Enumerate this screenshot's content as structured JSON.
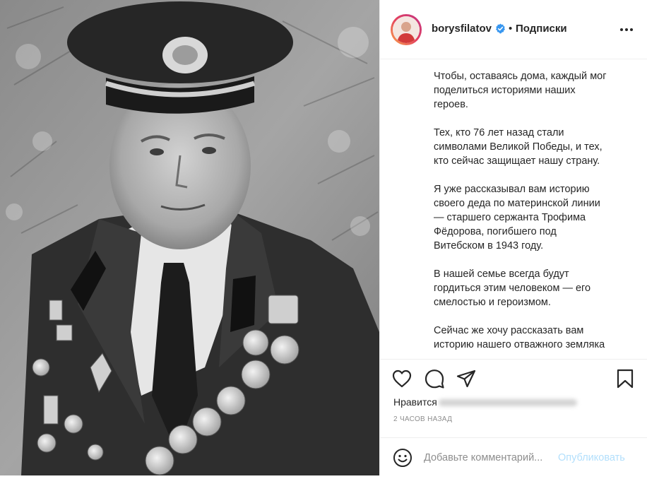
{
  "post": {
    "username": "borysfilatov",
    "verified_icon": "verified-badge-icon",
    "separator": "•",
    "follow_status": "Подписки",
    "more_icon": "more-options-icon"
  },
  "caption": {
    "paragraphs": [
      "Чтобы, оставаясь дома, каждый мог\nподелиться историями наших\nгероев.",
      "Тех, кто 76 лет назад стали\nсимволами Великой Победы, и тех,\nкто сейчас защищает нашу страну.",
      "Я уже рассказывал вам историю\nсвоего деда по материнской линии\n— старшего сержанта Трофима\nФёдорова, погибшего под\nВитебском в 1943 году.",
      "В нашей семье всегда будут\nгордиться этим человеком — его\nсмелостью и героизмом.",
      "Сейчас же хочу рассказать вам\nисторию нашего отважного земляка"
    ]
  },
  "actions": {
    "like_icon": "heart-icon",
    "comment_icon": "comment-icon",
    "share_icon": "paper-plane-icon",
    "save_icon": "bookmark-icon",
    "likes_label": "Нравится",
    "time": "2 ЧАСОВ НАЗАД"
  },
  "comment": {
    "emoji_icon": "emoji-icon",
    "placeholder": "Добавьте комментарий...",
    "publish_label": "Опубликовать"
  },
  "colors": {
    "verified": "#3897f0",
    "publish_disabled": "#b2dffc",
    "muted": "#8e8e8e"
  }
}
